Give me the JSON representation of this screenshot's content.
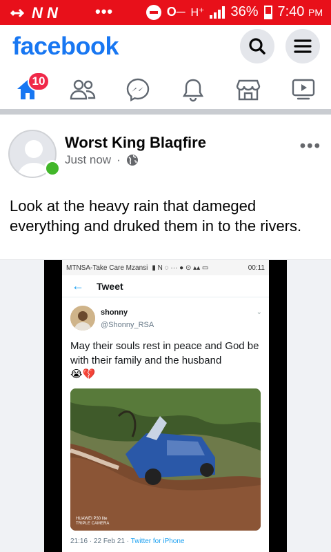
{
  "status_bar": {
    "carrier_icons": "N N",
    "overflow": "•••",
    "network": "H⁺",
    "battery": "36%",
    "time": "7:40",
    "ampm": "PM"
  },
  "header": {
    "logo": "facebook",
    "brand_color": "#1877f2"
  },
  "nav": {
    "home_badge": "10",
    "items": [
      "home-icon",
      "friends-icon",
      "messenger-icon",
      "notifications-icon",
      "marketplace-icon",
      "watch-icon"
    ]
  },
  "post": {
    "author": "Worst King Blaqfire",
    "time": "Just now",
    "separator": "·",
    "text": "Look at the heavy rain that dameged everything and druked them in to the rivers."
  },
  "tweet": {
    "status_carrier": "MTNSA-Take Care Mzansi",
    "status_time": "00:11",
    "title": "Tweet",
    "name": "shonny",
    "handle": "@Shonny_RSA",
    "text": "May their souls rest in peace and God be with their family and the husband",
    "emoji": "😭💔",
    "camera_line1": "HUAWEI P30 lite",
    "camera_line2": "TRIPLE CAMERA",
    "footer_date": "21:16 · 22 Feb 21 ·",
    "footer_source": "Twitter for iPhone"
  }
}
